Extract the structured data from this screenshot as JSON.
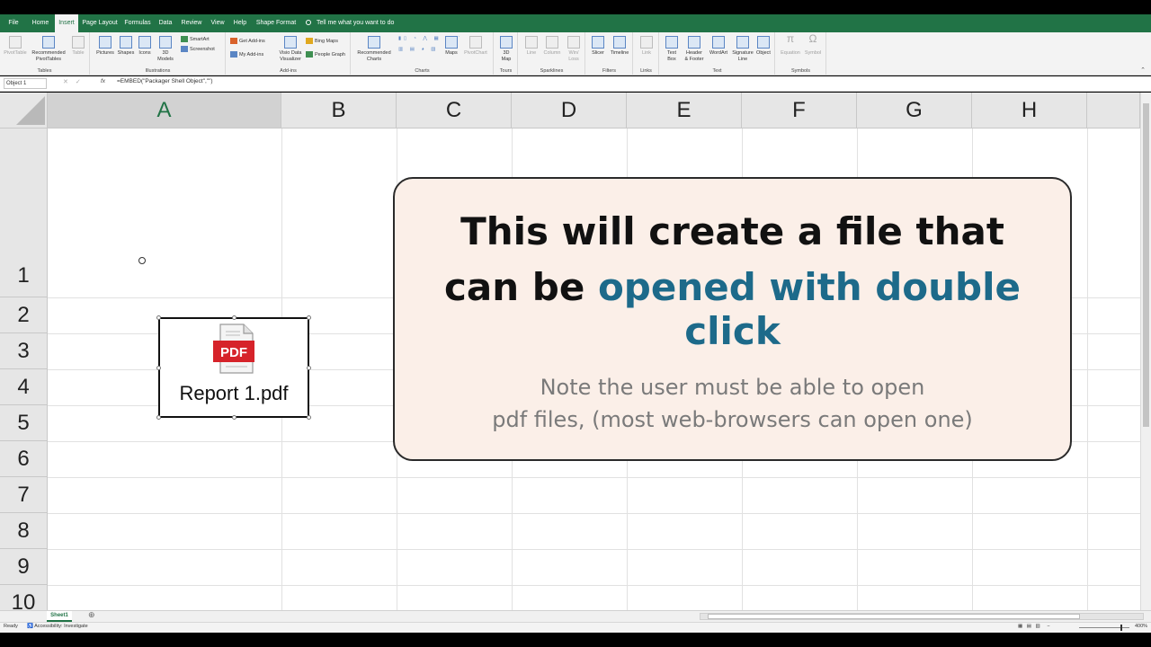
{
  "tabs": [
    "File",
    "Home",
    "Insert",
    "Page Layout",
    "Formulas",
    "Data",
    "Review",
    "View",
    "Help",
    "Shape Format"
  ],
  "active_tab": "Insert",
  "tell_me": "Tell me what you want to do",
  "ribbon": {
    "tables": {
      "label": "Tables",
      "pivot": "PivotTable",
      "recommended": "Recommended\nPivotTables",
      "table": "Table"
    },
    "illustrations": {
      "label": "Illustrations",
      "pictures": "Pictures",
      "shapes": "Shapes",
      "icons": "Icons",
      "models": "3D\nModels",
      "smartart": "SmartArt",
      "screenshot": "Screenshot"
    },
    "addins": {
      "label": "Add-ins",
      "get": "Get Add-ins",
      "my": "My Add-ins",
      "visio": "Visio Data\nVisualizer",
      "bing": "Bing Maps",
      "people": "People Graph"
    },
    "charts": {
      "label": "Charts",
      "recommended": "Recommended\nCharts",
      "maps": "Maps",
      "pivotchart": "PivotChart"
    },
    "tours": {
      "label": "Tours",
      "map3d": "3D\nMap"
    },
    "sparklines": {
      "label": "Sparklines",
      "line": "Line",
      "column": "Column",
      "winloss": "Win/\nLoss"
    },
    "filters": {
      "label": "Filters",
      "slicer": "Slicer",
      "timeline": "Timeline"
    },
    "links": {
      "label": "Links",
      "link": "Link"
    },
    "text": {
      "label": "Text",
      "textbox": "Text\nBox",
      "header": "Header\n& Footer",
      "wordart": "WordArt",
      "signature": "Signature\nLine",
      "object": "Object"
    },
    "symbols": {
      "label": "Symbols",
      "equation": "Equation",
      "symbol": "Symbol"
    }
  },
  "formula_bar": {
    "name_box": "Object 1",
    "fx": "fx",
    "formula": "=EMBED(\"Packager Shell Object\",\"\")"
  },
  "columns": [
    "A",
    "B",
    "C",
    "D",
    "E",
    "F",
    "G",
    "H"
  ],
  "rows": [
    "1",
    "2",
    "3",
    "4",
    "5",
    "6",
    "7",
    "8",
    "9",
    "10"
  ],
  "embedded_object": {
    "icon_text": "PDF",
    "filename": "Report 1.pdf"
  },
  "callout": {
    "line1": "This will create a file that",
    "line2_prefix": "can be ",
    "line2_highlight": "opened with double click",
    "note_line1": "Note the user must be able to open",
    "note_line2": "pdf files, (most web-browsers can open one)"
  },
  "sheet_tab": "Sheet1",
  "status": {
    "ready": "Ready",
    "accessibility": "Accessibility: Investigate",
    "zoom": "400%"
  },
  "colors": {
    "excel_green": "#217346",
    "highlight": "#1d6a8a",
    "pdf_red": "#d6232a",
    "callout_bg": "#fbefe8"
  }
}
